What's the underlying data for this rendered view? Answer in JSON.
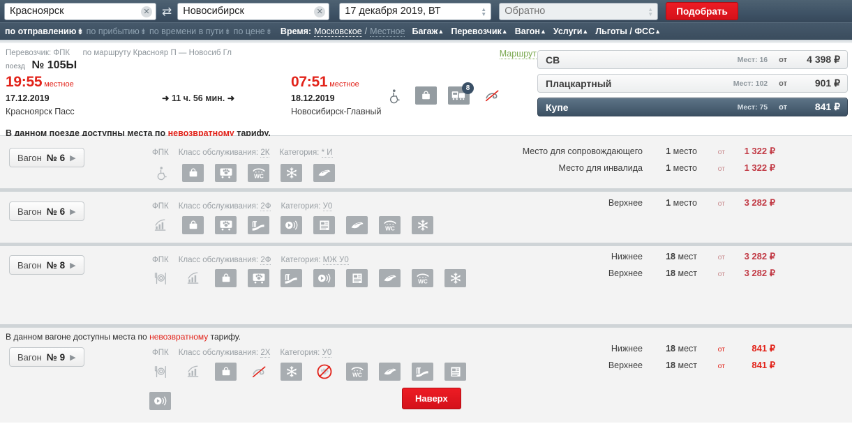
{
  "search": {
    "from_value": "Красноярск",
    "to_value": "Новосибирск",
    "date_value": "17 декабря 2019, ВТ",
    "back_placeholder": "Обратно",
    "swap_icon": "swap-arrows-icon",
    "clear_icon": "clear-icon",
    "submit_label": "Подобрать"
  },
  "filters": {
    "sort": [
      {
        "label": "по отправлению",
        "active": true
      },
      {
        "label": "по прибытию",
        "active": false
      },
      {
        "label": "по времени в пути",
        "active": false
      },
      {
        "label": "по цене",
        "active": false
      }
    ],
    "time_label": "Время:",
    "time_moscow": "Московское",
    "time_slash": "/",
    "time_local": "Местное",
    "dropdowns": [
      {
        "label": "Багаж"
      },
      {
        "label": "Перевозчик"
      },
      {
        "label": "Вагон"
      },
      {
        "label": "Услуги"
      },
      {
        "label": "Льготы / ФСС"
      }
    ]
  },
  "train": {
    "carrier_label": "Перевозчик: ФПК",
    "route_text": "по маршруту Краснояр П — Новосиб Гл",
    "route_link": "Маршрут",
    "train_word": "поезд",
    "train_number": "№ 105Ы",
    "departure": {
      "time": "19:55",
      "time_kind": "местное",
      "date": "17.12.2019",
      "station": "Красноярск Пасс"
    },
    "arrival": {
      "time": "07:51",
      "time_kind": "местное",
      "date": "18.12.2019",
      "station": "Новосибирск-Главный"
    },
    "duration": "11 ч. 56 мин.",
    "facility_icons": [
      {
        "name": "wheelchair-access-icon",
        "boxed": false
      },
      {
        "name": "luggage-icon",
        "boxed": true
      },
      {
        "name": "wagon-count-icon",
        "boxed": true,
        "badge": "8"
      },
      {
        "name": "non-refundable-icon",
        "boxed": false
      }
    ],
    "notice_prefix": "В данном поезде доступны места по ",
    "notice_highlight": "невозвратному",
    "notice_suffix": " тарифу.",
    "classes": [
      {
        "name": "СВ",
        "seats_label": "Мест: 16",
        "from": "от",
        "price": "4 398 ₽",
        "selected": false
      },
      {
        "name": "Плацкартный",
        "seats_label": "Мест: 102",
        "from": "от",
        "price": "901 ₽",
        "selected": false
      },
      {
        "name": "Купе",
        "seats_label": "Мест: 75",
        "from": "от",
        "price": "841 ₽",
        "selected": true
      }
    ]
  },
  "wagons": [
    {
      "button_label": "Вагон",
      "number": "№ 6",
      "carrier": "ФПК",
      "service_key": "Класс обслуживания:",
      "service_value": "2К",
      "category_key": "Категория:",
      "category_value": "* И",
      "icons": [
        {
          "name": "wheelchair-access-icon",
          "boxed": false
        },
        {
          "name": "luggage-icon",
          "boxed": true
        },
        {
          "name": "pet-transport-icon",
          "boxed": true
        },
        {
          "name": "shower-wc-icon",
          "boxed": true
        },
        {
          "name": "air-conditioning-icon",
          "boxed": true
        },
        {
          "name": "bedding-icon",
          "boxed": true
        }
      ],
      "prices": [
        {
          "place": "Место для сопровождающего",
          "count": "1",
          "unit": "место",
          "from": "от",
          "price": "1 322 ₽"
        },
        {
          "place": "Место для инвалида",
          "count": "1",
          "unit": "место",
          "from": "от",
          "price": "1 322 ₽"
        }
      ],
      "highlight": false,
      "notice": null
    },
    {
      "button_label": "Вагон",
      "number": "№ 6",
      "carrier": "ФПК",
      "service_key": "Класс обслуживания:",
      "service_value": "2Ф",
      "category_key": "Категория:",
      "category_value": "У0",
      "icons": [
        {
          "name": "wifi-icon",
          "boxed": false
        },
        {
          "name": "luggage-icon",
          "boxed": true
        },
        {
          "name": "pet-transport-icon",
          "boxed": true
        },
        {
          "name": "linens-icon",
          "boxed": true
        },
        {
          "name": "multimedia-icon",
          "boxed": true
        },
        {
          "name": "press-icon",
          "boxed": true
        },
        {
          "name": "bedding-icon",
          "boxed": true
        },
        {
          "name": "shower-wc-icon",
          "boxed": true
        },
        {
          "name": "air-conditioning-icon",
          "boxed": true
        }
      ],
      "prices": [
        {
          "place": "Верхнее",
          "count": "1",
          "unit": "место",
          "from": "от",
          "price": "3 282 ₽"
        }
      ],
      "highlight": false,
      "notice": null
    },
    {
      "button_label": "Вагон",
      "number": "№ 8",
      "carrier": "ФПК",
      "service_key": "Класс обслуживания:",
      "service_value": "2Ф",
      "category_key": "Категория:",
      "category_value": "МЖ У0",
      "icons": [
        {
          "name": "restaurant-icon",
          "boxed": false
        },
        {
          "name": "wifi-icon",
          "boxed": false
        },
        {
          "name": "luggage-icon",
          "boxed": true
        },
        {
          "name": "pet-transport-icon",
          "boxed": true
        },
        {
          "name": "linens-icon",
          "boxed": true
        },
        {
          "name": "multimedia-icon",
          "boxed": true
        },
        {
          "name": "press-icon",
          "boxed": true
        },
        {
          "name": "bedding-icon",
          "boxed": true
        },
        {
          "name": "shower-wc-icon",
          "boxed": true
        },
        {
          "name": "air-conditioning-icon",
          "boxed": true
        }
      ],
      "prices": [
        {
          "place": "Нижнее",
          "count": "18",
          "unit": "мест",
          "from": "от",
          "price": "3 282 ₽"
        },
        {
          "place": "Верхнее",
          "count": "18",
          "unit": "мест",
          "from": "от",
          "price": "3 282 ₽"
        }
      ],
      "highlight": false,
      "notice": null
    },
    {
      "button_label": "Вагон",
      "number": "№ 9",
      "carrier": "ФПК",
      "service_key": "Класс обслуживания:",
      "service_value": "2Х",
      "category_key": "Категория:",
      "category_value": "У0",
      "icons": [
        {
          "name": "restaurant-icon",
          "boxed": false
        },
        {
          "name": "wifi-icon",
          "boxed": false
        },
        {
          "name": "luggage-icon",
          "boxed": true
        },
        {
          "name": "non-refundable-icon",
          "boxed": false
        },
        {
          "name": "air-conditioning-icon",
          "boxed": true
        },
        {
          "name": "no-pets-icon",
          "boxed": false
        },
        {
          "name": "shower-wc-icon",
          "boxed": true
        },
        {
          "name": "bedding-icon",
          "boxed": true
        },
        {
          "name": "linens-icon",
          "boxed": true
        },
        {
          "name": "press-icon",
          "boxed": true
        },
        {
          "name": "multimedia-icon",
          "boxed": true
        }
      ],
      "prices": [
        {
          "place": "Нижнее",
          "count": "18",
          "unit": "мест",
          "from": "от",
          "price": "841 ₽"
        },
        {
          "place": "Верхнее",
          "count": "18",
          "unit": "мест",
          "from": "от",
          "price": "841 ₽"
        }
      ],
      "highlight": true,
      "notice_prefix": "В данном вагоне доступны места по ",
      "notice_highlight": "невозвратному",
      "notice_suffix": " тарифу."
    }
  ],
  "scroll_top_label": "Наверх",
  "colors": {
    "brand_red": "#e2231a",
    "header_blue": "#3e5265",
    "selected_class": "#4a5f73",
    "route_link_green": "#7aa84f"
  }
}
